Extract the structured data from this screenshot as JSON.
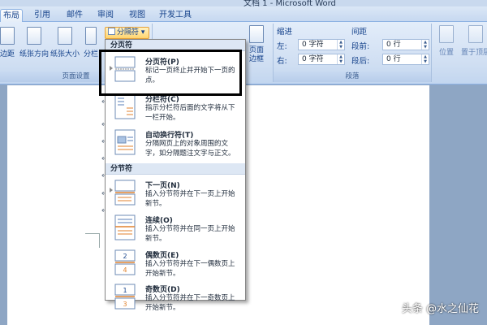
{
  "window": {
    "title": "文档 1 - Microsoft Word"
  },
  "tabs": [
    {
      "label": "布局",
      "active": true
    },
    {
      "label": "引用",
      "active": false
    },
    {
      "label": "邮件",
      "active": false
    },
    {
      "label": "审阅",
      "active": false
    },
    {
      "label": "视图",
      "active": false
    },
    {
      "label": "开发工具",
      "active": false
    }
  ],
  "ribbon": {
    "page_setup": {
      "group_label": "页面设置",
      "margins_label": "边距",
      "orientation_label": "纸张方向",
      "size_label": "纸张大小",
      "columns_label": "分栏",
      "breaks_label": "分隔符"
    },
    "page_border_label": "页面边框",
    "indent": {
      "title": "缩进",
      "left_label": "左:",
      "left_value": "0 字符",
      "right_label": "右:",
      "right_value": "0 字符"
    },
    "spacing": {
      "title": "间距",
      "before_label": "段前:",
      "before_value": "0 行",
      "after_label": "段后:",
      "after_value": "0 行"
    },
    "paragraph_group_label": "段落",
    "arrange": {
      "position_label": "位置",
      "bring_front_label": "置于顶层"
    }
  },
  "dropdown": {
    "page_breaks_header": "分页符",
    "section_breaks_header": "分节符",
    "items": [
      {
        "title": "分页符(P)",
        "desc": "标记一页终止并开始下一页的点。"
      },
      {
        "title": "分栏符(C)",
        "desc": "指示分栏符后面的文字将从下一栏开始。"
      },
      {
        "title": "自动换行符(T)",
        "desc": "分隔网页上的对象周围的文字，如分隔题注文字与正文。"
      },
      {
        "title": "下一页(N)",
        "desc": "插入分节符并在下一页上开始新节。"
      },
      {
        "title": "连续(O)",
        "desc": "插入分节符并在同一页上开始新节。"
      },
      {
        "title": "偶数页(E)",
        "desc": "插入分节符并在下一偶数页上开始新节。"
      },
      {
        "title": "奇数页(D)",
        "desc": "插入分节符并在下一奇数页上开始新节。"
      }
    ]
  },
  "document": {
    "paragraph_mark": "↵"
  },
  "watermark": "头条 @水之仙花",
  "colors": {
    "highlight_border": "#000000",
    "breaks_button_bg": "#ffd46e",
    "ribbon_bg": "#cfdef2"
  }
}
